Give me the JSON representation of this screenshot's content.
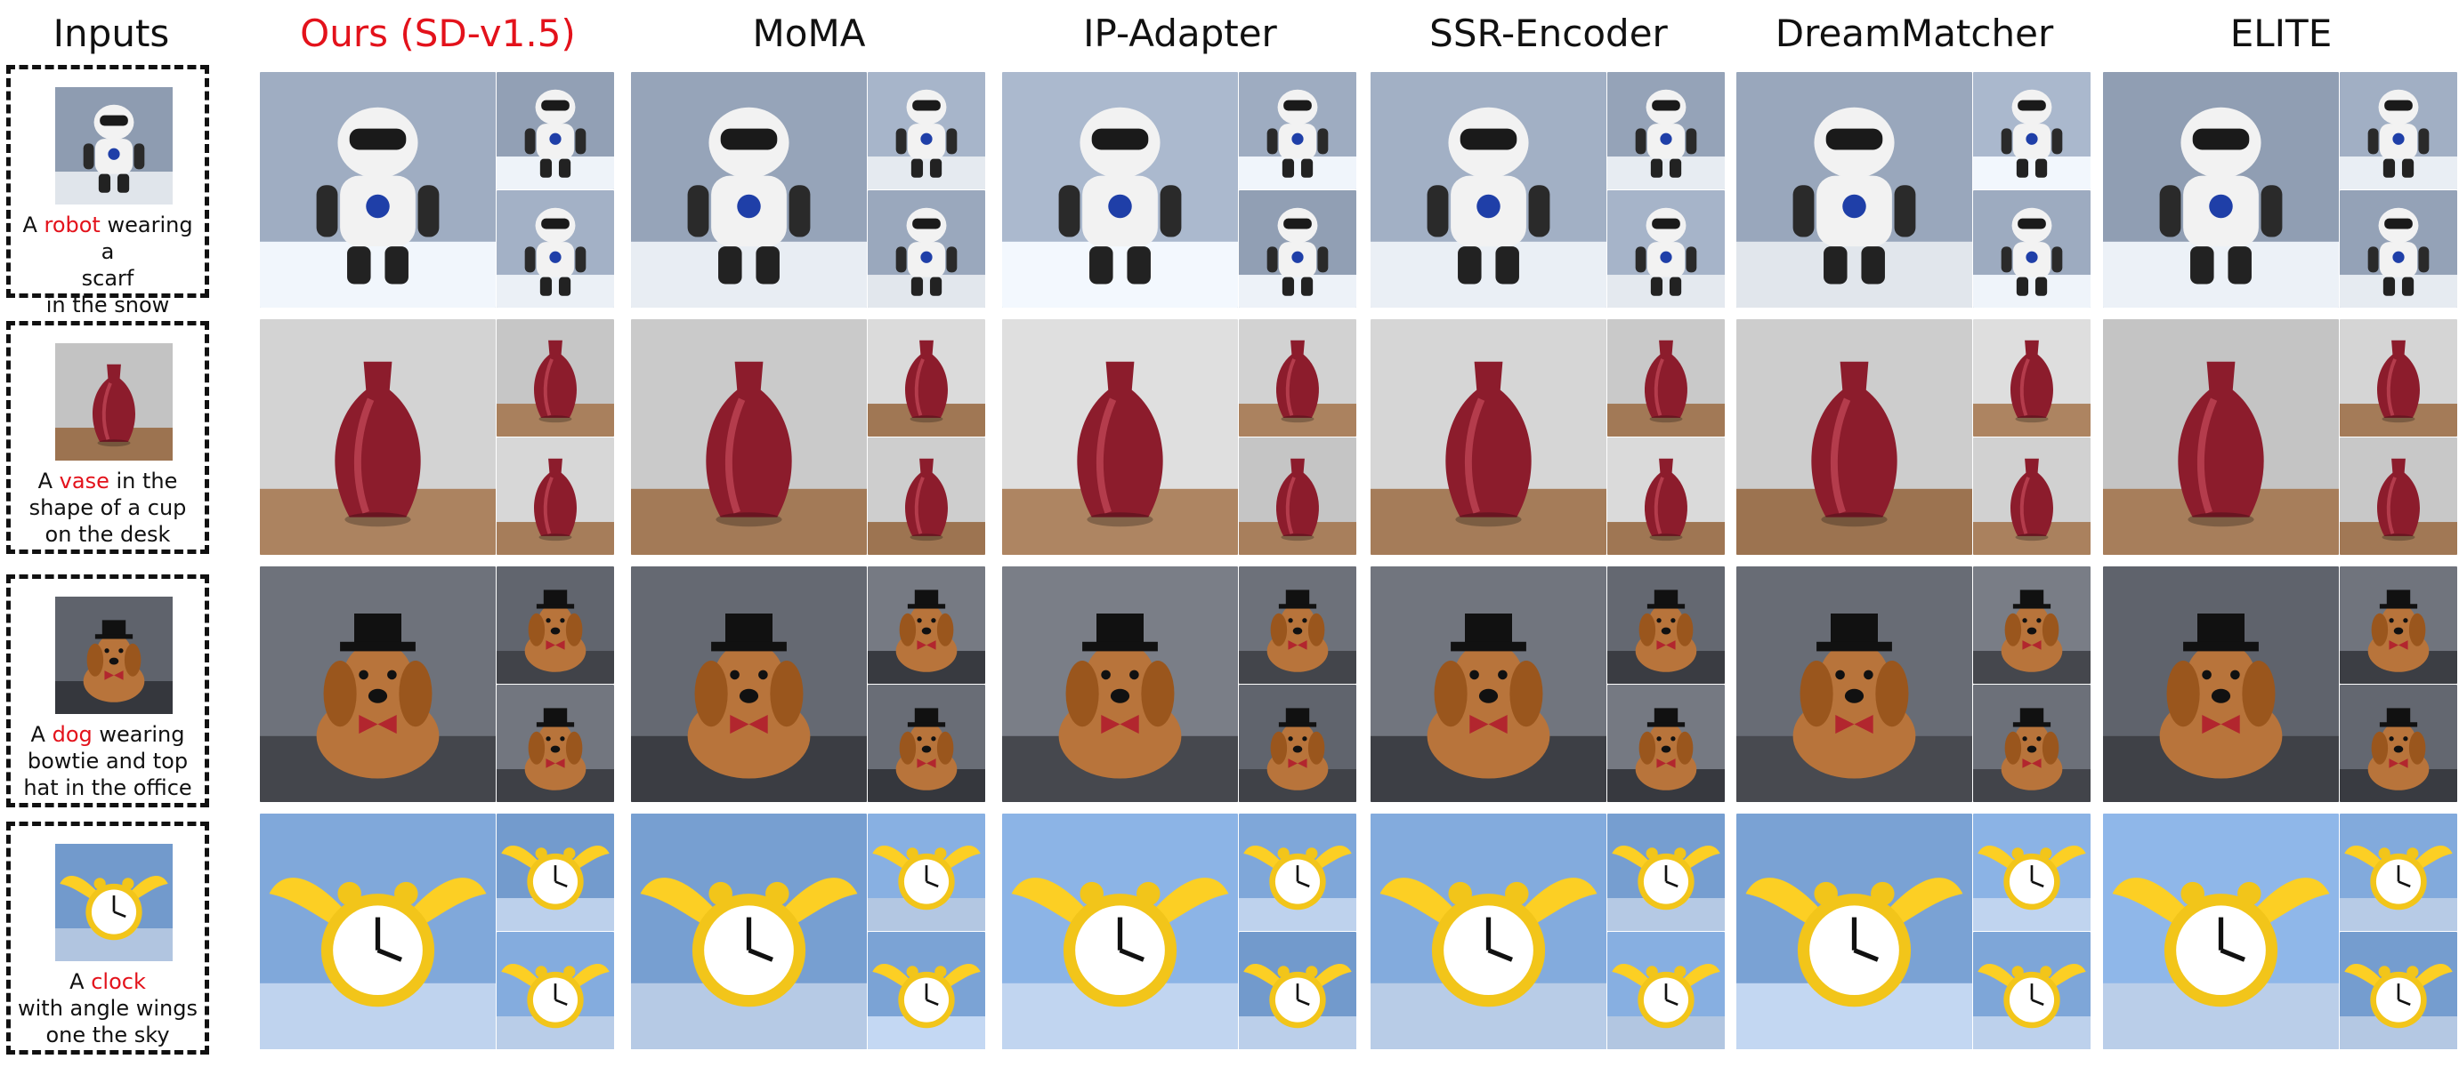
{
  "headers": {
    "inputs": "Inputs",
    "methods": [
      "Ours (SD-v1.5)",
      "MoMA",
      "IP-Adapter",
      "SSR-Encoder",
      "DreamMatcher",
      "ELITE"
    ],
    "ours_color": "#e3121b"
  },
  "rows": [
    {
      "subject": "robot",
      "prompt_pre": "A ",
      "keyword": "robot",
      "prompt_post_1": " wearing a",
      "prompt_line2": "scarf",
      "prompt_line3": "in the snow",
      "palette": {
        "bg": "#9aa8bd",
        "subject": "#f2f2f2",
        "accent": "#1f3fa8",
        "ground": "#e8edf3"
      }
    },
    {
      "subject": "vase",
      "prompt_pre": "A ",
      "keyword": "vase",
      "prompt_post_1": " in the",
      "prompt_line2": "shape of a cup",
      "prompt_line3": "on the desk",
      "palette": {
        "bg": "#cfcfcf",
        "subject": "#8c1c2c",
        "accent": "#c44a5a",
        "ground": "#a47b58"
      }
    },
    {
      "subject": "dog",
      "prompt_pre": "A ",
      "keyword": "dog",
      "prompt_post_1": " wearing",
      "prompt_line2": "bowtie and top",
      "prompt_line3": "hat in the office",
      "palette": {
        "bg": "#6b6f78",
        "subject": "#b8743b",
        "accent": "#111111",
        "ground": "#3d3f45"
      }
    },
    {
      "subject": "clock",
      "prompt_pre": "A ",
      "keyword": "clock",
      "prompt_post_1": "",
      "prompt_line2": "with angle wings",
      "prompt_line3": "one the sky",
      "palette": {
        "bg": "#7ea6d8",
        "subject": "#f2c51a",
        "accent": "#ffffff",
        "ground": "#b9cde8"
      }
    }
  ]
}
